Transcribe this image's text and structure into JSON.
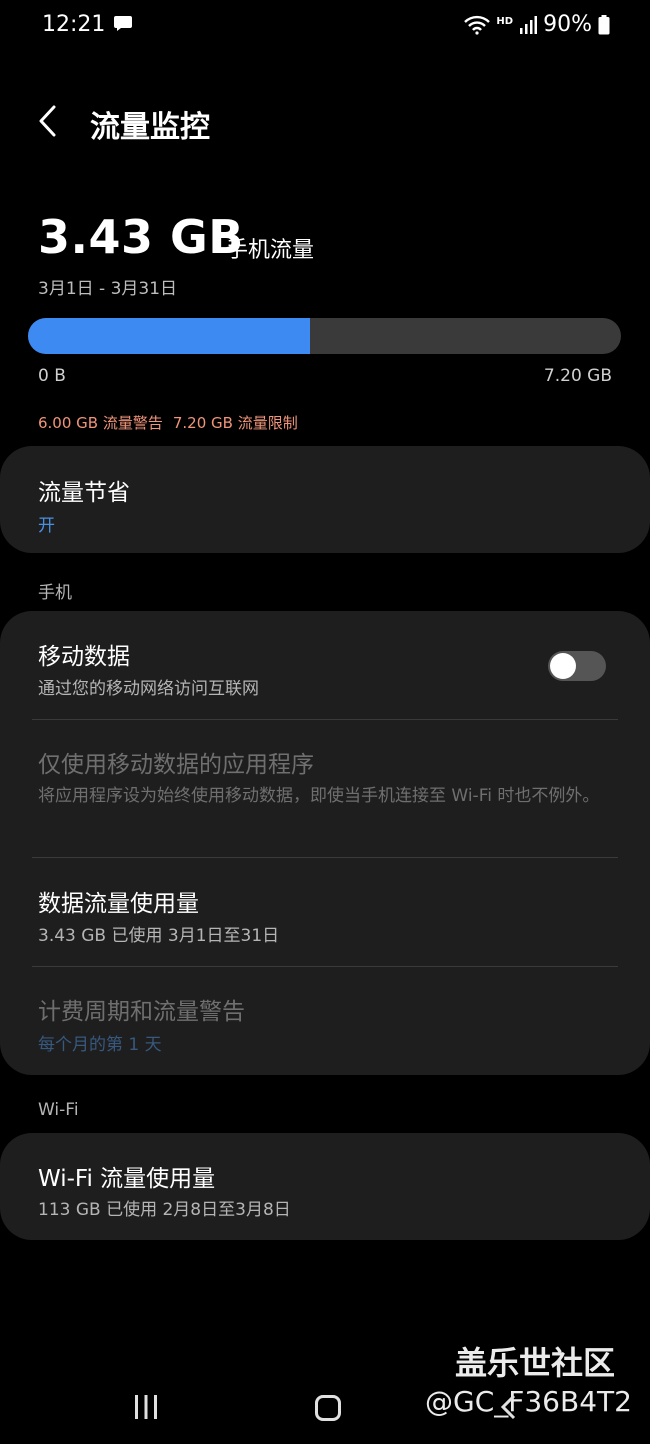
{
  "status_bar": {
    "time": "12:21",
    "hd": "HD",
    "battery": "90%"
  },
  "header": {
    "title": "流量监控"
  },
  "usage": {
    "amount": "3.43 GB",
    "label": "手机流量",
    "period": "3月1日 - 3月31日",
    "progress_fraction": 0.476,
    "bar_min": "0 B",
    "bar_max": "7.20 GB",
    "warning": "6.00 GB 流量警告",
    "limit": "7.20 GB 流量限制",
    "bar_color": "#3d8bf2"
  },
  "data_saver": {
    "title": "流量节省",
    "state": "开"
  },
  "mobile_section": {
    "header": "手机",
    "items": [
      {
        "title": "移动数据",
        "subtitle": "通过您的移动网络访问互联网",
        "toggle_on": false
      },
      {
        "title": "仅使用移动数据的应用程序",
        "subtitle": "将应用程序设为始终使用移动数据，即使当手机连接至 Wi-Fi 时也不例外。"
      },
      {
        "title": "数据流量使用量",
        "subtitle": "3.43 GB 已使用 3月1日至31日"
      },
      {
        "title": "计费周期和流量警告",
        "subtitle": "每个月的第 1 天"
      }
    ]
  },
  "wifi_section": {
    "header": "Wi-Fi",
    "items": [
      {
        "title": "Wi-Fi 流量使用量",
        "subtitle": "113 GB 已使用 2月8日至3月8日"
      }
    ]
  },
  "watermark": {
    "line1": "盖乐世社区",
    "line2": "@GC_F36B4T2"
  }
}
